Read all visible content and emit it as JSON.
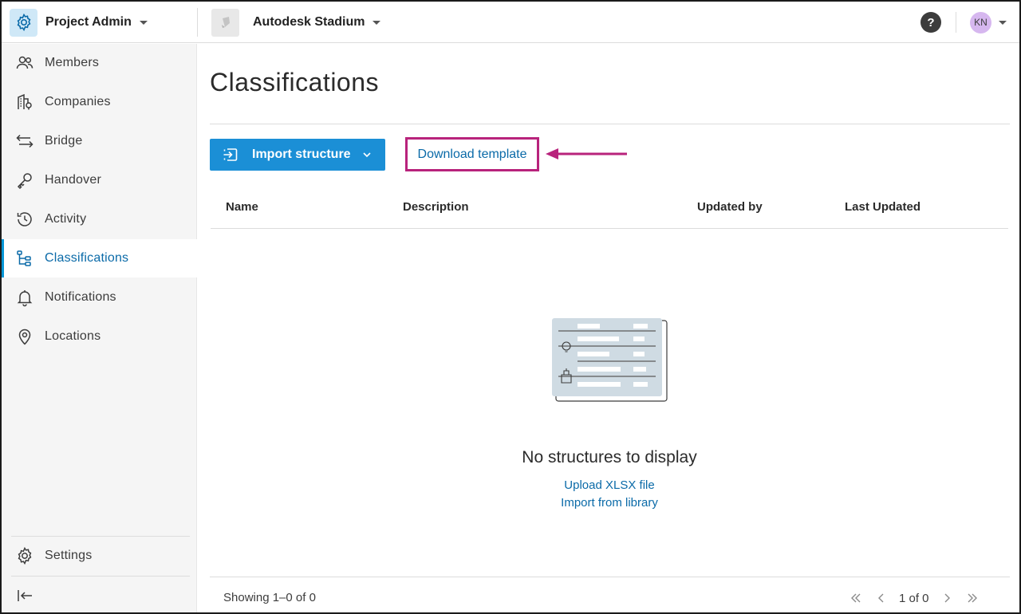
{
  "colors": {
    "accent": "#0696d7",
    "primary_button": "#1b8fd6",
    "link": "#0a6aa8",
    "highlight_box": "#b8237c",
    "avatar_bg": "#d6b7ef"
  },
  "header": {
    "app_name": "Project Admin",
    "project_name": "Autodesk Stadium",
    "help_label": "?",
    "user_initials": "KN"
  },
  "sidebar": {
    "items": [
      {
        "label": "Members",
        "icon": "members-icon"
      },
      {
        "label": "Companies",
        "icon": "companies-icon"
      },
      {
        "label": "Bridge",
        "icon": "bridge-icon"
      },
      {
        "label": "Handover",
        "icon": "handover-icon"
      },
      {
        "label": "Activity",
        "icon": "activity-icon"
      },
      {
        "label": "Classifications",
        "icon": "classifications-icon",
        "active": true
      },
      {
        "label": "Notifications",
        "icon": "bell-icon"
      },
      {
        "label": "Locations",
        "icon": "location-pin-icon"
      }
    ],
    "settings_label": "Settings",
    "collapse_icon": "collapse-sidebar-icon"
  },
  "main": {
    "title": "Classifications",
    "import_button": "Import structure",
    "download_template": "Download template",
    "table": {
      "columns": [
        "Name",
        "Description",
        "Updated by",
        "Last Updated"
      ]
    },
    "empty_state": {
      "title": "No structures to display",
      "upload_link": "Upload XLSX file",
      "library_link": "Import from library"
    },
    "footer": {
      "showing": "Showing 1–0 of 0",
      "page_indicator": "1 of 0"
    }
  }
}
